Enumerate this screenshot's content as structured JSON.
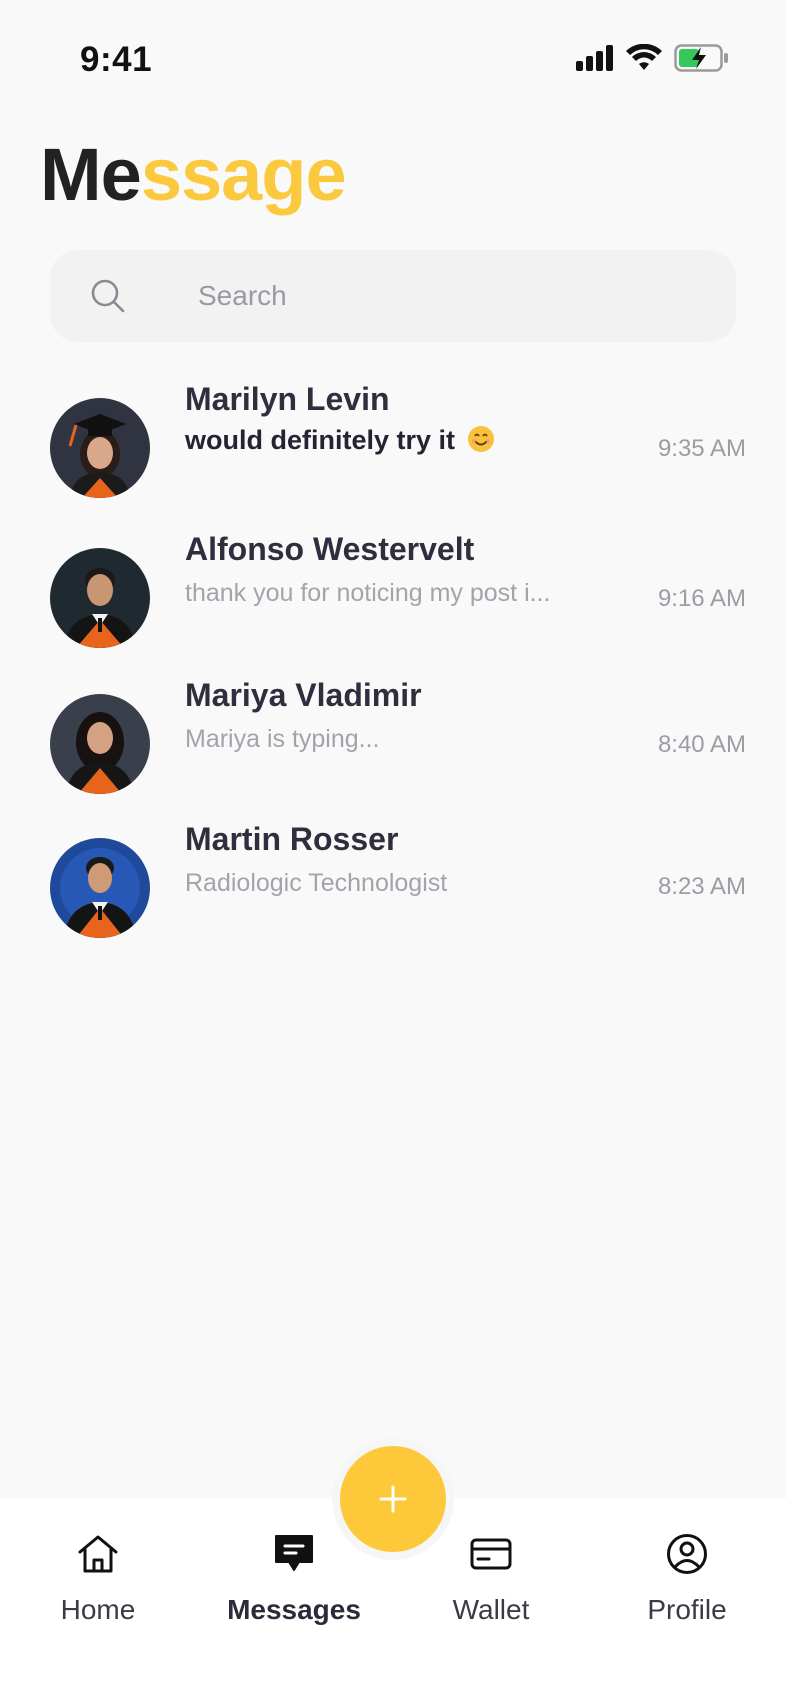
{
  "status_bar": {
    "time": "9:41",
    "signal_icon": "cellular-signal-icon",
    "wifi_icon": "wifi-icon",
    "battery_icon": "battery-charging-icon"
  },
  "title": {
    "part1": "Me",
    "part2": "ssage",
    "accent_color": "#fbc93d"
  },
  "search": {
    "placeholder": "Search",
    "value": "",
    "icon": "search-icon"
  },
  "chats": [
    {
      "name": "Marilyn Levin",
      "preview": "would definitely try it",
      "emoji": "smiling-face-emoji",
      "time": "9:35 AM",
      "unread": true
    },
    {
      "name": "Alfonso Westervelt",
      "preview": "thank you for noticing my post i...",
      "time": "9:16 AM",
      "unread": false
    },
    {
      "name": "Mariya Vladimir",
      "preview": "Mariya is typing...",
      "time": "8:40 AM",
      "unread": false
    },
    {
      "name": "Martin Rosser",
      "preview": "Radiologic Technologist",
      "time": "8:23 AM",
      "unread": false
    }
  ],
  "fab": {
    "icon": "plus-icon",
    "color": "#fdc93a"
  },
  "nav": {
    "home": {
      "label": "Home",
      "icon": "home-icon"
    },
    "messages": {
      "label": "Messages",
      "icon": "chat-bubble-icon",
      "active": true
    },
    "wallet": {
      "label": "Wallet",
      "icon": "card-icon"
    },
    "profile": {
      "label": "Profile",
      "icon": "user-circle-icon"
    }
  }
}
